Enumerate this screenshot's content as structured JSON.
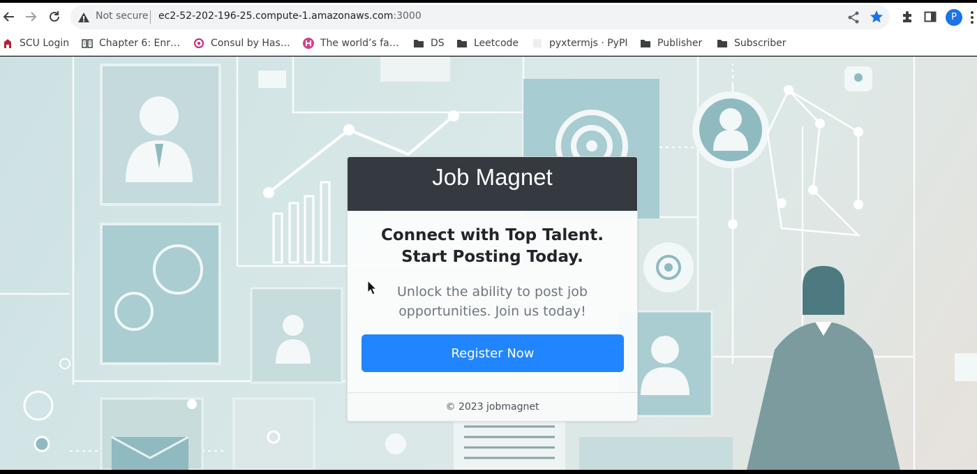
{
  "browser": {
    "security_label": "Not secure",
    "url_host": "ec2-52-202-196-25.compute-1.amazonaws.com",
    "url_port": ":3000",
    "profile_initial": "P",
    "accent_color": "#1a73e8"
  },
  "bookmarks": [
    {
      "label": "SCU Login",
      "icon": "scu-icon"
    },
    {
      "label": "Chapter 6: Enr…",
      "icon": "book-icon"
    },
    {
      "label": "Consul by Has…",
      "icon": "consul-icon"
    },
    {
      "label": "The world’s fa…",
      "icon": "h-badge-icon"
    },
    {
      "label": "DS",
      "icon": "folder-icon"
    },
    {
      "label": "Leetcode",
      "icon": "folder-icon"
    },
    {
      "label": "pyxtermjs · PyPI",
      "icon": "pypi-icon"
    },
    {
      "label": "Publisher",
      "icon": "folder-icon"
    },
    {
      "label": "Subscriber",
      "icon": "folder-icon"
    }
  ],
  "card": {
    "brand": "Job Magnet",
    "headline": "Connect with Top Talent. Start Posting Today.",
    "subtext": "Unlock the ability to post job opportunities. Join us today!",
    "cta_label": "Register Now",
    "footer": "© 2023 jobmagnet",
    "header_color": "#343a40",
    "button_color": "#2185ff"
  }
}
